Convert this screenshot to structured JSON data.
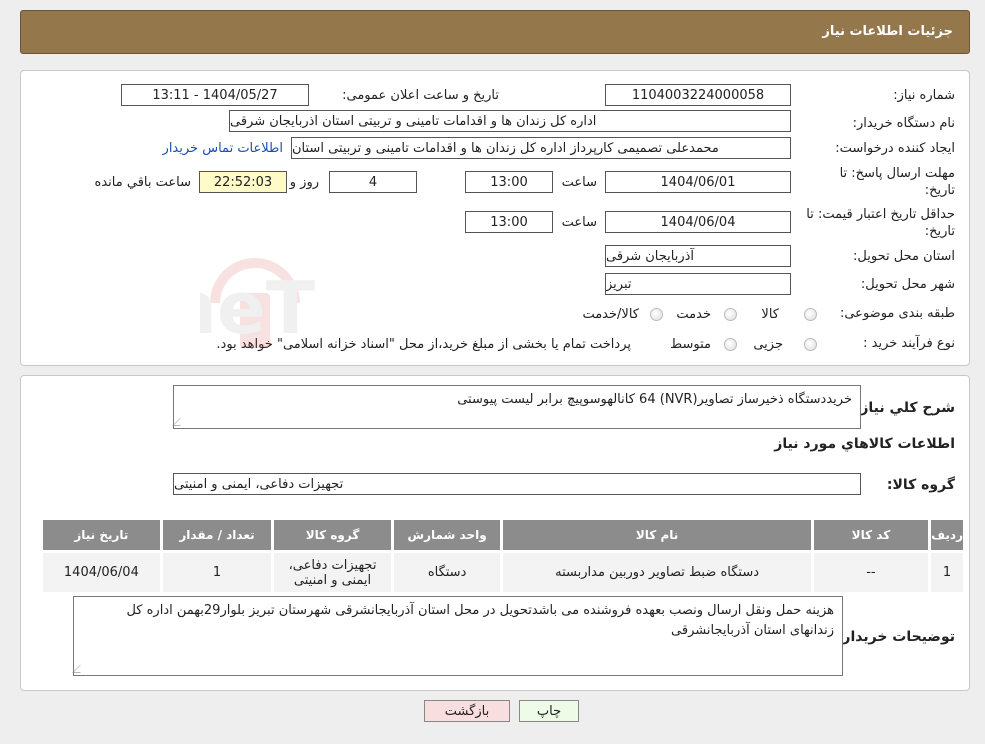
{
  "header": {
    "title": "جزئیات اطلاعات نیاز"
  },
  "form": {
    "need_number_label": "شماره نیاز:",
    "need_number": "1104003224000058",
    "announce_label": "تاریخ و ساعت اعلان عمومی:",
    "announce_value": "1404/05/27 - 13:11",
    "buyer_org_label": "نام دستگاه خریدار:",
    "buyer_org": "اداره کل زندان ها و اقدامات تامینی و تربیتی استان اذربایجان شرقی",
    "creator_label": "ایجاد کننده درخواست:",
    "creator": "محمدعلی تصمیمی کارپرداز اداره کل زندان ها و اقدامات تامینی و تربیتی استان",
    "contact_link": "اطلاعات تماس خریدار",
    "deadline_label_1": "مهلت ارسال پاسخ: تا",
    "deadline_label_2": "تاریخ:",
    "deadline_date": "1404/06/01",
    "time_label": "ساعت",
    "deadline_time": "13:00",
    "days": "4",
    "days_label": "روز و",
    "remaining": "22:52:03",
    "remaining_label": "ساعت باقي مانده",
    "validity_label_1": "حداقل تاریخ اعتبار قیمت: تا",
    "validity_label_2": "تاریخ:",
    "validity_date": "1404/06/04",
    "validity_time": "13:00",
    "province_label": "استان محل تحویل:",
    "province": "آذربایجان شرقی",
    "city_label": "شهر محل تحویل:",
    "city": "تبریز",
    "category_label": "طبقه بندی موضوعی:",
    "category_options": [
      "کالا",
      "خدمت",
      "کالا/خدمت"
    ],
    "process_label": "نوع فرآیند خرید :",
    "process_options": [
      "جزیی",
      "متوسط"
    ],
    "process_note": "پرداخت تمام یا بخشی از مبلغ خرید،از محل \"اسناد خزانه اسلامی\" خواهد بود."
  },
  "details": {
    "summary_label": "شرح کلي نياز:",
    "summary": "خریددستگاه ذخیرساز تصاویر(NVR) 64 کانالهوسوپیچ برابر لیست پیوستی",
    "goods_info_title": "اطلاعات کالاهاي مورد نياز",
    "goods_group_label": "گروه کالا:",
    "goods_group": "تجهیزات دفاعی، ایمنی و امنیتی",
    "table": {
      "headers": [
        "ردیف",
        "کد کالا",
        "نام کالا",
        "واحد شمارش",
        "گروه کالا",
        "تعداد / مقدار",
        "تاریخ نیاز"
      ],
      "rows": [
        [
          "1",
          "--",
          "دستگاه ضبط تصاویر دوربین مداربسته",
          "دستگاه",
          "تجهیزات دفاعی، ایمنی و امنیتی",
          "1",
          "1404/06/04"
        ]
      ]
    },
    "buyer_notes_label": "توضیحات خریدار:",
    "buyer_notes": "هزینه حمل ونقل ارسال ونصب بعهده فروشنده می باشدتحویل در محل استان آذربایجانشرقی شهرستان تبریز بلوار29بهمن اداره کل زندانهای استان آذربایجانشرقی"
  },
  "buttons": {
    "print": "چاپ",
    "back": "بازگشت"
  },
  "watermark": {
    "text": "AriaTender.neT"
  }
}
